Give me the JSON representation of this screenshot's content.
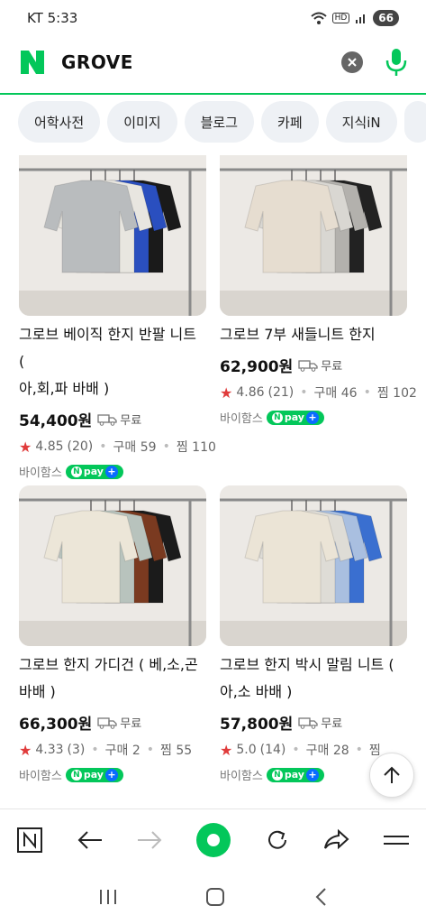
{
  "status": {
    "carrier": "KT",
    "time": "5:33",
    "battery": "66",
    "hd": "HD"
  },
  "search": {
    "query": "GROVE"
  },
  "tabs": [
    "어학사전",
    "이미지",
    "블로그",
    "카페",
    "지식iN"
  ],
  "products": [
    {
      "title_line1": "그로브 베이직 한지 반팔 니트 (",
      "title_line2": "아,회,파 바배 )",
      "price": "54,400원",
      "shipping": "무료",
      "rating": "4.85",
      "reviews": "(20)",
      "purchases": "구매 59",
      "likes": "찜 110",
      "seller": "바이함스",
      "colors": [
        "#b9bcbe",
        "#e8e6e0",
        "#2a4fbf",
        "#1a1a1a"
      ]
    },
    {
      "title_line1": "그로브 7부 새들니트 한지",
      "title_line2": "",
      "price": "62,900원",
      "shipping": "무료",
      "rating": "4.86",
      "reviews": "(21)",
      "purchases": "구매 46",
      "likes": "찜 102",
      "seller": "바이함스",
      "colors": [
        "#e6ddd0",
        "#d9d7d2",
        "#b3b1ad",
        "#222222"
      ]
    },
    {
      "title_line1": "그로브 한지 가디건 ( 베,소,곤",
      "title_line2": "바배 )",
      "price": "66,300원",
      "shipping": "무료",
      "rating": "4.33",
      "reviews": "(3)",
      "purchases": "구매 2",
      "likes": "찜 55",
      "seller": "바이함스",
      "colors": [
        "#ece6d8",
        "#b8c3bd",
        "#7a3a20",
        "#1b1b1b"
      ]
    },
    {
      "title_line1": "그로브 한지 박시 말림 니트 (",
      "title_line2": "아,소 바배 )",
      "price": "57,800원",
      "shipping": "무료",
      "rating": "5.0",
      "reviews": "(14)",
      "purchases": "구매 28",
      "likes": "찜",
      "seller": "바이함스",
      "colors": [
        "#ebe4d6",
        "#dedcd6",
        "#a9bfe0",
        "#3a6fd0"
      ]
    }
  ],
  "npay_label": "pay",
  "icons": {
    "logo": "naver-n-logo",
    "clear": "clear-icon",
    "mic": "mic-icon",
    "scroll_top": "arrow-up-icon"
  }
}
